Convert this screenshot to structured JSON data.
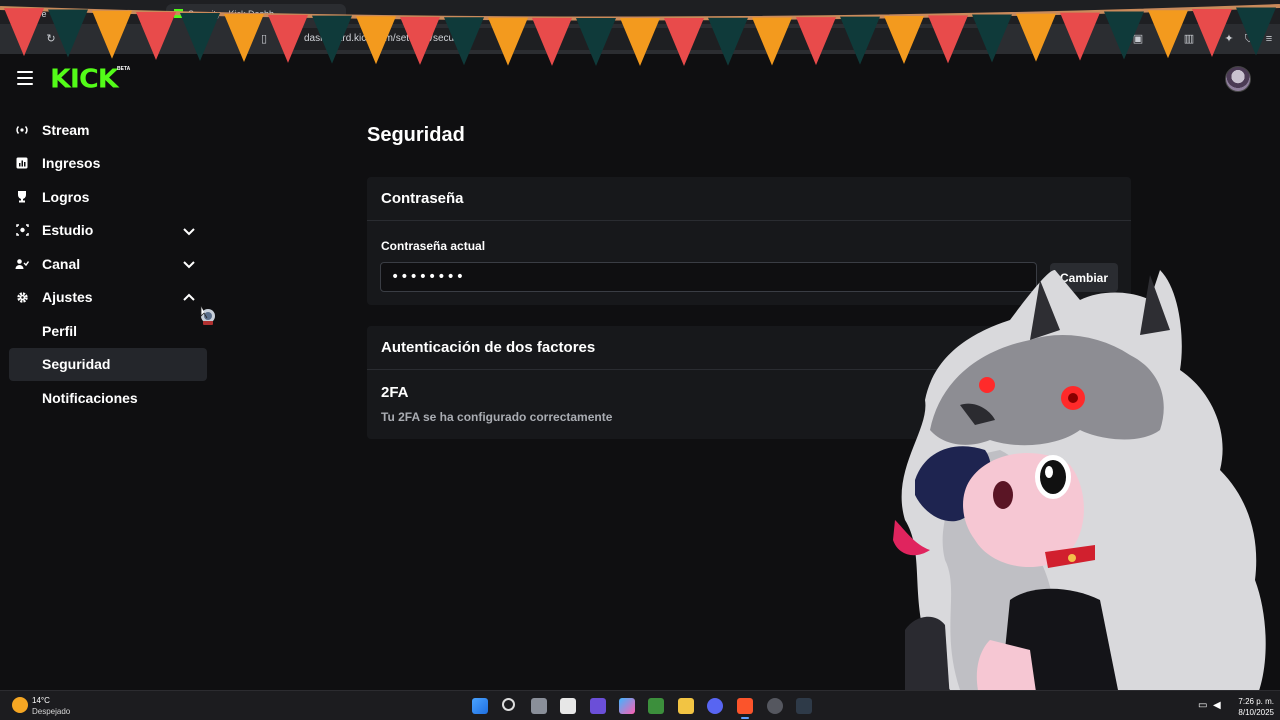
{
  "browser": {
    "tabs": [
      {
        "label": "Stre"
      },
      {
        "label": "Security - Kick Dashb"
      }
    ],
    "address": "dashboard.kick.com/settings/security"
  },
  "header": {
    "logo": "KICK",
    "beta": "BETA"
  },
  "sidebar": {
    "items": [
      {
        "label": "Stream",
        "icon": "broadcast-icon"
      },
      {
        "label": "Ingresos",
        "icon": "chart-icon"
      },
      {
        "label": "Logros",
        "icon": "trophy-icon"
      },
      {
        "label": "Estudio",
        "icon": "studio-icon"
      },
      {
        "label": "Canal",
        "icon": "users-icon"
      },
      {
        "label": "Ajustes",
        "icon": "gear-icon"
      }
    ],
    "subitems": [
      {
        "label": "Perfil"
      },
      {
        "label": "Seguridad"
      },
      {
        "label": "Notificaciones"
      }
    ]
  },
  "main": {
    "title": "Seguridad",
    "password": {
      "heading": "Contraseña",
      "field_label": "Contraseña actual",
      "value": "••••••••",
      "button": "Cambiar"
    },
    "twofa": {
      "heading": "Autenticación de dos factores",
      "title": "2FA",
      "description": "Tu 2FA se ha configurado correctamente"
    }
  },
  "taskbar": {
    "temp": "14°C",
    "condition": "Despejado",
    "time": "7:26 p. m.",
    "date": "8/10/2025"
  },
  "colors": {
    "brand": "#53fc18",
    "background": "#0f0f11",
    "card": "#17181b"
  }
}
